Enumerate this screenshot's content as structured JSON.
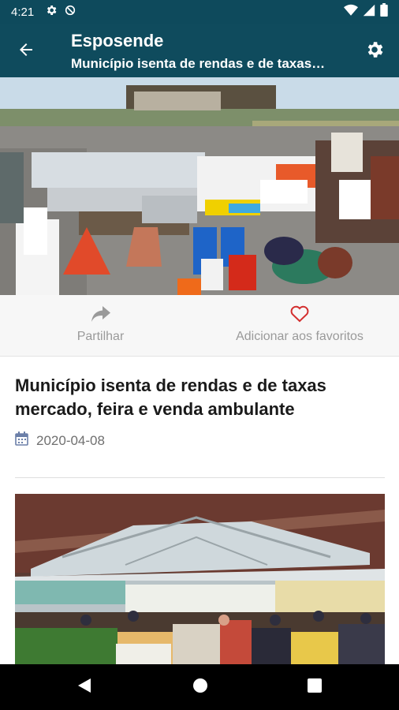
{
  "status_bar": {
    "time": "4:21",
    "left_icons": [
      "gear-icon",
      "sync-off-icon"
    ],
    "right_icons": [
      "wifi-icon",
      "cellular-signal-icon",
      "battery-icon"
    ]
  },
  "app_bar": {
    "title": "Esposende",
    "subtitle": "Município isenta de rendas e de taxas…",
    "back_icon": "arrow-back-icon",
    "settings_icon": "gear-icon",
    "background": "#0f4b5d"
  },
  "actions": {
    "share_label": "Partilhar",
    "share_icon": "share-arrow-icon",
    "favorite_label": "Adicionar aos favoritos",
    "favorite_icon": "heart-outline-icon",
    "favorite_color": "#d32f2f"
  },
  "article": {
    "title": "Município isenta de rendas e de taxas mercado, feira e venda ambulante",
    "date": "2020-04-08",
    "date_icon": "calendar-icon"
  },
  "navigation": {
    "back_icon": "triangle-back-icon",
    "home_icon": "circle-home-icon",
    "recents_icon": "square-recents-icon"
  }
}
